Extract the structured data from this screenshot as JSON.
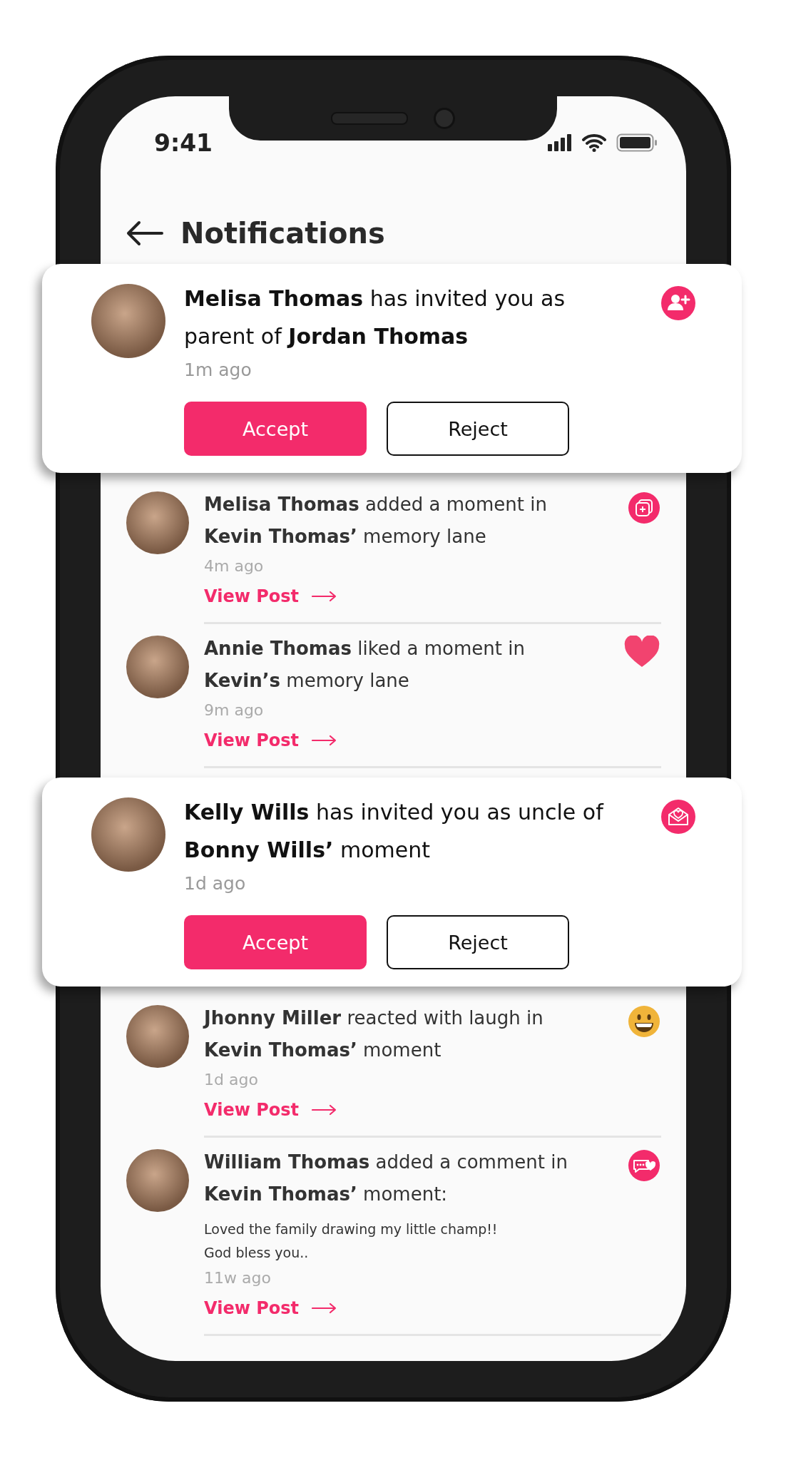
{
  "status_bar": {
    "time": "9:41"
  },
  "header": {
    "title": "Notifications"
  },
  "notifications": [
    {
      "kind": "invite",
      "text": "**Melisa Thomas** has invited you as parent of **Jordan Thomas**",
      "time": "1m ago",
      "actions": [
        {
          "label": "Accept",
          "kind": "primary"
        },
        {
          "label": "Reject",
          "kind": "outline"
        }
      ]
    },
    {
      "kind": "activity",
      "text": "**Melisa Thomas** added a moment in **Kevin Thomas’** memory lane",
      "time": "4m ago",
      "link": "View Post"
    },
    {
      "kind": "activity",
      "text": "**Annie Thomas** liked a moment in **Kevin’s** memory lane",
      "time": "9m ago",
      "link": "View Post"
    },
    {
      "kind": "invite",
      "text": "**Kelly Wills** has invited you as uncle of **Bonny Wills’** moment",
      "time": "1d ago",
      "actions": [
        {
          "label": "Accept",
          "kind": "primary"
        },
        {
          "label": "Reject",
          "kind": "outline"
        }
      ]
    },
    {
      "kind": "activity",
      "text": "**Jhonny Miller** reacted with laugh in **Kevin Thomas’** moment",
      "time": "1d ago",
      "link": "View Post"
    },
    {
      "kind": "activity",
      "text": "**William Thomas** added a comment in **Kevin Thomas’** moment:",
      "comment": "Loved the family drawing my little champ!!\nGod bless you..",
      "time": "11w ago",
      "link": "View Post"
    }
  ]
}
